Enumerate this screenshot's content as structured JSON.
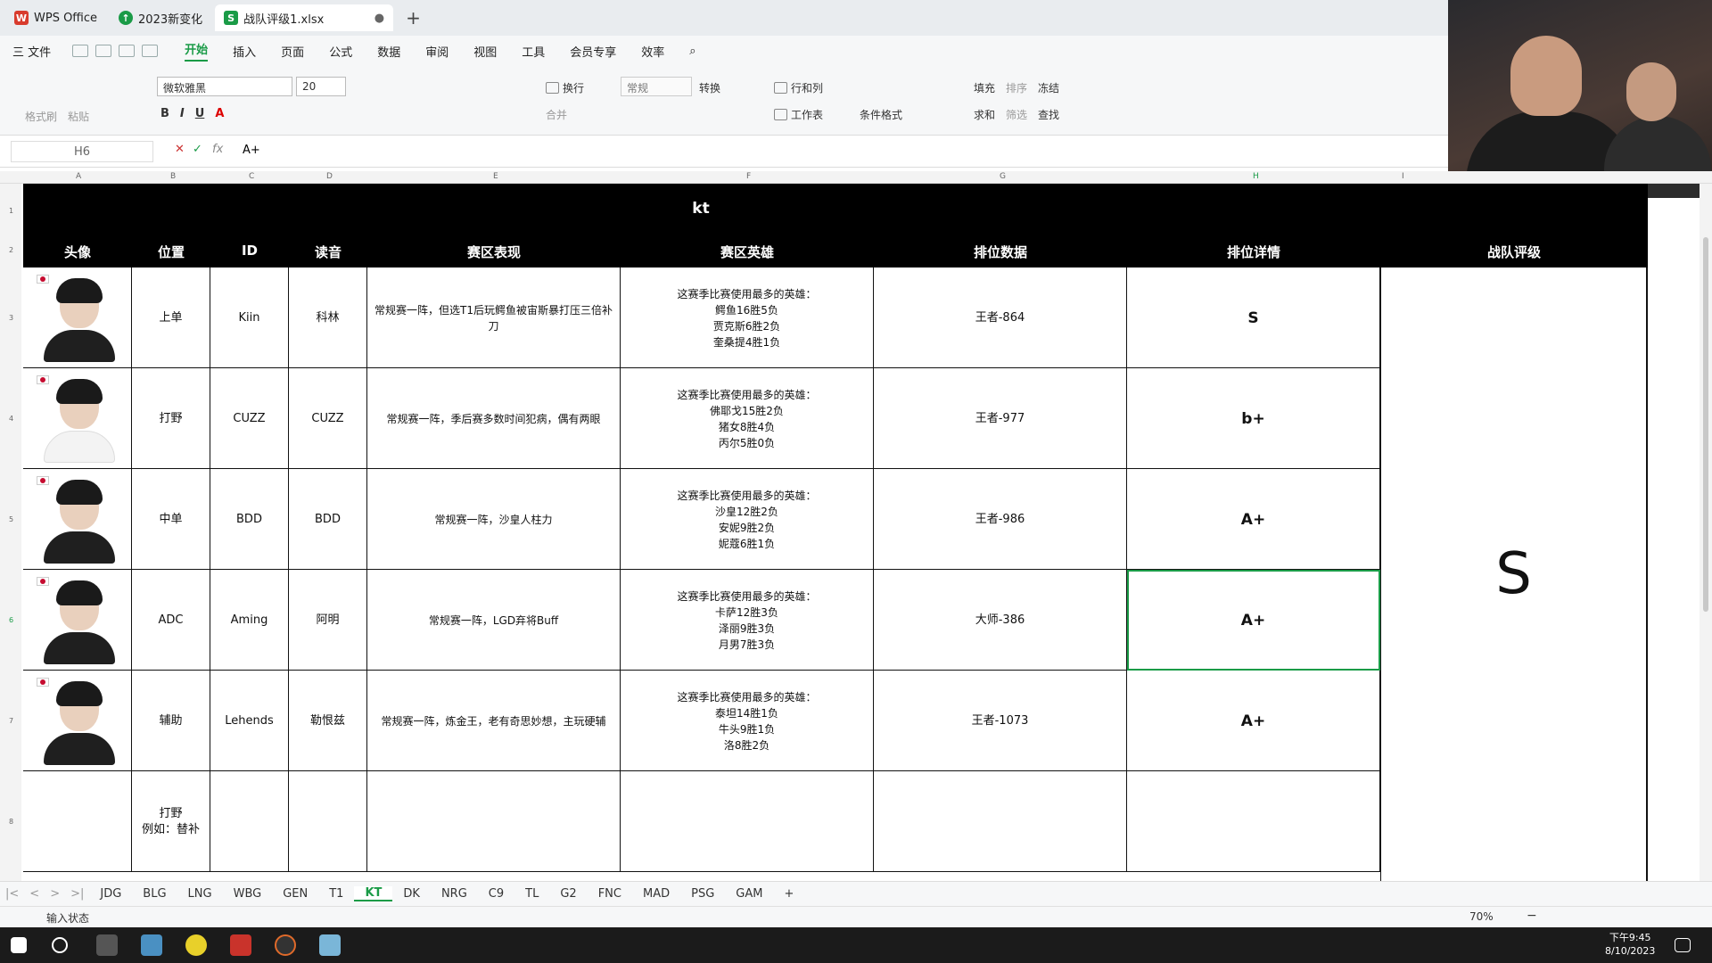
{
  "window_tabs": [
    {
      "label": "WPS Office",
      "icon": "wps-logo-icon",
      "color": "#d83b2d"
    },
    {
      "label": "2023新变化",
      "icon": "update-circle-icon",
      "color": "#1a9b47"
    },
    {
      "label": "战队评级1.xlsx",
      "icon": "spreadsheet-s-icon",
      "color": "#1a9b47"
    }
  ],
  "menu": {
    "file": "三 文件",
    "items": [
      "开始",
      "插入",
      "页面",
      "公式",
      "数据",
      "审阅",
      "视图",
      "工具",
      "会员专享",
      "效率"
    ],
    "active": "开始"
  },
  "ribbon": {
    "format_painter": "格式刷",
    "paste": "粘贴",
    "font_name": "微软雅黑",
    "font_size": "20",
    "wrap": "换行",
    "number_format": "常规",
    "convert": "转换",
    "rows_cols": "行和列",
    "worksheet": "工作表",
    "conditional_format": "条件格式",
    "fill": "填充",
    "sort": "排序",
    "freeze": "冻结",
    "sum": "求和",
    "filter": "筛选",
    "find": "查找",
    "merge": "合并"
  },
  "formula_bar": {
    "cell_ref": "H6",
    "fx": "fx",
    "value": "A+"
  },
  "columns": [
    "A",
    "B",
    "C",
    "D",
    "E",
    "F",
    "G",
    "H",
    "I"
  ],
  "sheet": {
    "title": "kt",
    "headers": [
      "头像",
      "位置",
      "ID",
      "读音",
      "赛区表现",
      "赛区英雄",
      "排位数据",
      "排位详情",
      "战队评级"
    ],
    "team_grade": "S",
    "rows": [
      {
        "pos": "上单",
        "id": "Kiin",
        "pron": "科林",
        "perf": "常规赛一阵，但选T1后玩鳄鱼被宙斯暴打压三倍补刀",
        "heroes": [
          "这赛季比赛使用最多的英雄：",
          "鳄鱼16胜5负",
          "贾克斯6胜2负",
          "奎桑提4胜1负"
        ],
        "rank": "王者-864",
        "grade": "S",
        "skin": "dark"
      },
      {
        "pos": "打野",
        "id": "CUZZ",
        "pron": "CUZZ",
        "perf": "常规赛一阵，季后赛多数时间犯病，偶有两眼",
        "heroes": [
          "这赛季比赛使用最多的英雄：",
          "佛耶戈15胜2负",
          "猪女8胜4负",
          "丙尔5胜0负"
        ],
        "rank": "王者-977",
        "grade": "b+",
        "skin": "light"
      },
      {
        "pos": "中单",
        "id": "BDD",
        "pron": "BDD",
        "perf": "常规赛一阵，沙皇人柱力",
        "heroes": [
          "这赛季比赛使用最多的英雄：",
          "沙皇12胜2负",
          "安妮9胜2负",
          "妮蔻6胜1负"
        ],
        "rank": "王者-986",
        "grade": "A+",
        "skin": "dark"
      },
      {
        "pos": "ADC",
        "id": "Aming",
        "pron": "阿明",
        "perf": "常规赛一阵，LGD弃将Buff",
        "heroes": [
          "这赛季比赛使用最多的英雄：",
          "卡萨12胜3负",
          "泽丽9胜3负",
          "月男7胜3负"
        ],
        "rank": "大师-386",
        "grade": "A+",
        "skin": "dark"
      },
      {
        "pos": "辅助",
        "id": "Lehends",
        "pron": "勒恨兹",
        "perf": "常规赛一阵，炼金王，老有奇思妙想，主玩硬辅",
        "heroes": [
          "这赛季比赛使用最多的英雄：",
          "泰坦14胜1负",
          "牛头9胜1负",
          "洛8胜2负"
        ],
        "rank": "王者-1073",
        "grade": "A+",
        "skin": "dark"
      },
      {
        "pos": "打野\n例如：替补",
        "id": "",
        "pron": "",
        "perf": "",
        "heroes": [],
        "rank": "",
        "grade": "",
        "skin": "none"
      }
    ]
  },
  "sheet_tabs": [
    "JDG",
    "BLG",
    "LNG",
    "WBG",
    "GEN",
    "T1",
    "KT",
    "DK",
    "NRG",
    "C9",
    "TL",
    "G2",
    "FNC",
    "MAD",
    "PSG",
    "GAM"
  ],
  "active_sheet": "KT",
  "status": {
    "mode": "输入状态",
    "zoom": "70%"
  },
  "taskbar": {
    "time": "下午9:45",
    "date": "8/10/2023"
  }
}
